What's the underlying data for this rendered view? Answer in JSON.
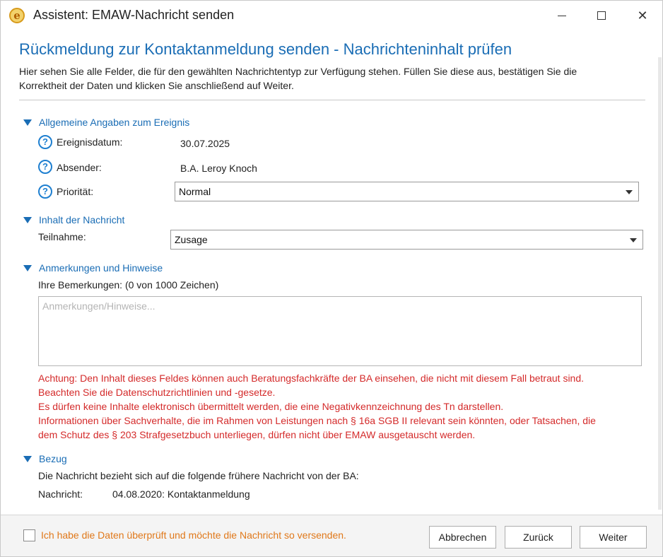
{
  "window": {
    "title": "Assistent: EMAW-Nachricht senden",
    "app_icon_letter": "e"
  },
  "header": {
    "title": "Rückmeldung zur Kontaktanmeldung senden - Nachrichteninhalt prüfen",
    "intro_line1": "Hier sehen Sie alle Felder, die für den gewählten Nachrichtentyp zur Verfügung stehen. Füllen Sie diese aus, bestätigen Sie die",
    "intro_line2": "Korrektheit der Daten und klicken Sie anschließend auf Weiter."
  },
  "general": {
    "section_title": "Allgemeine Angaben zum Ereignis",
    "event_date_label": "Ereignisdatum:",
    "event_date_value": "30.07.2025",
    "sender_label": "Absender:",
    "sender_value": "B.A. Leroy Knoch",
    "priority_label": "Priorität:",
    "priority_value": "Normal"
  },
  "message": {
    "section_title": "Inhalt der Nachricht",
    "participation_label": "Teilnahme:",
    "participation_value": "Zusage"
  },
  "remarks": {
    "section_title": "Anmerkungen und Hinweise",
    "label": "Ihre Bemerkungen: (0 von 1000 Zeichen)",
    "placeholder": "Anmerkungen/Hinweise...",
    "warning_lines": [
      "Achtung: Den Inhalt dieses Feldes können auch Beratungsfachkräfte der BA einsehen, die nicht mit diesem Fall betraut sind.",
      "Beachten Sie die Datenschutzrichtlinien und -gesetze.",
      "Es dürfen keine Inhalte elektronisch übermittelt werden, die eine Negativkennzeichnung des Tn darstellen.",
      "Informationen über Sachverhalte, die im Rahmen von Leistungen nach § 16a SGB II relevant sein könnten, oder Tatsachen, die",
      "dem Schutz des § 203 Strafgesetzbuch unterliegen, dürfen nicht über EMAW ausgetauscht werden."
    ]
  },
  "reference": {
    "section_title": "Bezug",
    "description": "Die Nachricht bezieht sich auf die folgende frühere Nachricht von der BA:",
    "message_label": "Nachricht:",
    "message_value": "04.08.2020: Kontaktanmeldung"
  },
  "footer": {
    "confirm_label": "Ich habe die Daten überprüft und möchte die Nachricht so versenden.",
    "cancel_label": "Abbrechen",
    "back_label": "Zurück",
    "next_label": "Weiter"
  },
  "colors": {
    "accent": "#1a6db5",
    "warning": "#d42a2a",
    "confirm": "#e0781a"
  }
}
